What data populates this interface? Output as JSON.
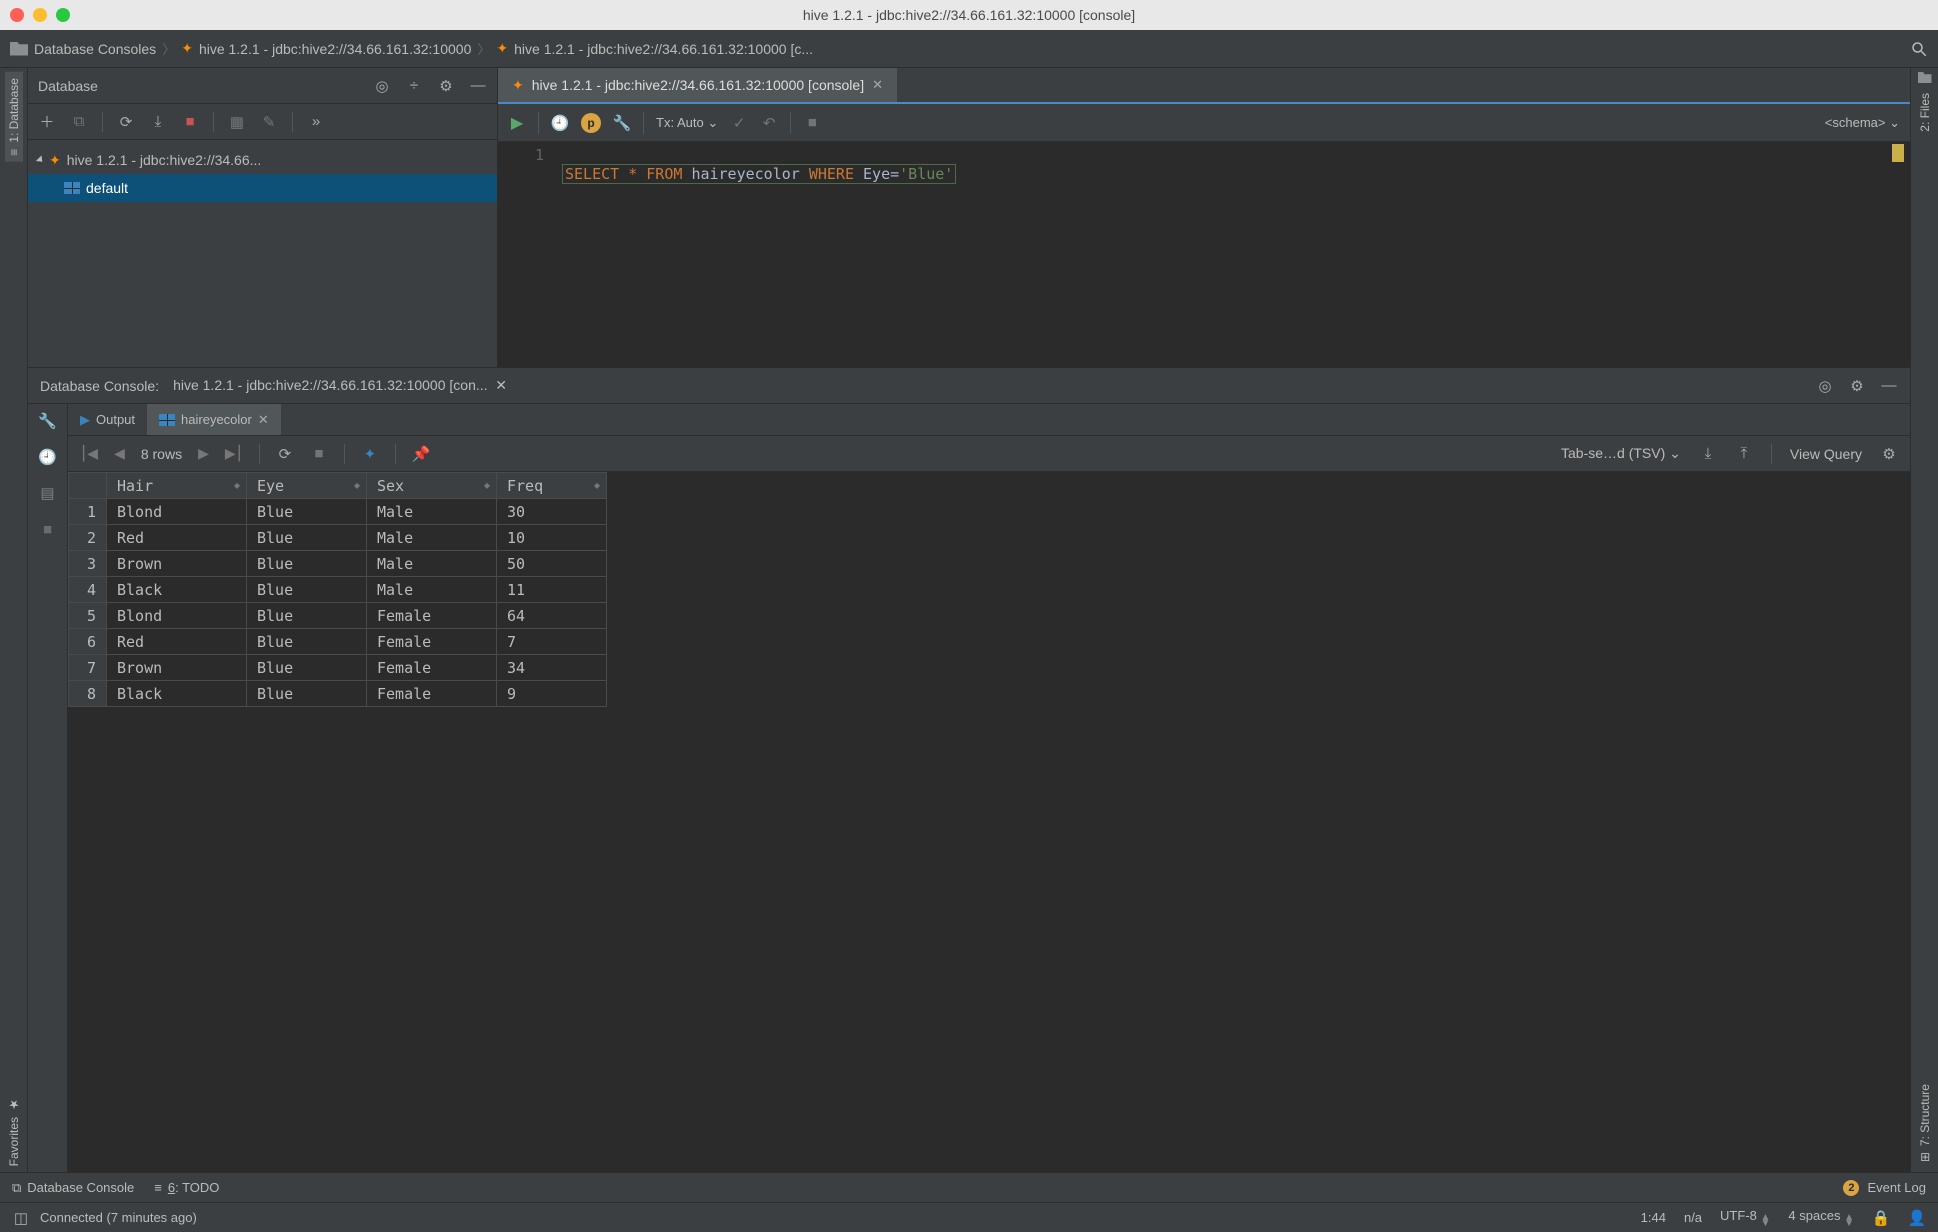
{
  "window": {
    "title": "hive 1.2.1 - jdbc:hive2://34.66.161.32:10000 [console]"
  },
  "breadcrumbs": {
    "root": "Database Consoles",
    "mid": "hive 1.2.1 - jdbc:hive2://34.66.161.32:10000",
    "leaf": "hive 1.2.1 - jdbc:hive2://34.66.161.32:10000 [c..."
  },
  "left_tabs": {
    "database": "1: Database",
    "favorites": "Favorites"
  },
  "right_tabs": {
    "files": "2: Files",
    "structure": "7: Structure"
  },
  "db_panel": {
    "title": "Database",
    "tree": {
      "node": "hive 1.2.1 - jdbc:hive2://34.66...",
      "child": "default"
    }
  },
  "editor": {
    "tab": "hive 1.2.1 - jdbc:hive2://34.66.161.32:10000 [console]",
    "tx": "Tx: Auto",
    "schema": "<schema>",
    "line_no": "1",
    "sql": {
      "kw1": "SELECT",
      "star": "*",
      "kw2": "FROM",
      "table": "haireyecolor",
      "kw3": "WHERE",
      "col": "Eye",
      "eq": "=",
      "val": "'Blue'"
    }
  },
  "console": {
    "title": "Database Console:",
    "tabname": "hive 1.2.1 - jdbc:hive2://34.66.161.32:10000 [con...",
    "tab_output": "Output",
    "tab_result": "haireyecolor",
    "rows": "8 rows",
    "format": "Tab-se…d (TSV)",
    "view_query": "View Query"
  },
  "table": {
    "columns": [
      "Hair",
      "Eye",
      "Sex",
      "Freq"
    ],
    "rows": [
      {
        "n": "1",
        "Hair": "Blond",
        "Eye": "Blue",
        "Sex": "Male",
        "Freq": "30"
      },
      {
        "n": "2",
        "Hair": "Red",
        "Eye": "Blue",
        "Sex": "Male",
        "Freq": "10"
      },
      {
        "n": "3",
        "Hair": "Brown",
        "Eye": "Blue",
        "Sex": "Male",
        "Freq": "50"
      },
      {
        "n": "4",
        "Hair": "Black",
        "Eye": "Blue",
        "Sex": "Male",
        "Freq": "11"
      },
      {
        "n": "5",
        "Hair": "Blond",
        "Eye": "Blue",
        "Sex": "Female",
        "Freq": "64"
      },
      {
        "n": "6",
        "Hair": "Red",
        "Eye": "Blue",
        "Sex": "Female",
        "Freq": "7"
      },
      {
        "n": "7",
        "Hair": "Brown",
        "Eye": "Blue",
        "Sex": "Female",
        "Freq": "34"
      },
      {
        "n": "8",
        "Hair": "Black",
        "Eye": "Blue",
        "Sex": "Female",
        "Freq": "9"
      }
    ]
  },
  "toolstrip": {
    "db_console": "Database Console",
    "todo_prefix": "6",
    "todo": ": TODO",
    "event_log_badge": "2",
    "event_log": "Event Log"
  },
  "statusbar": {
    "msg": "Connected (7 minutes ago)",
    "pos": "1:44",
    "na": "n/a",
    "enc": "UTF-8",
    "indent": "4 spaces"
  }
}
